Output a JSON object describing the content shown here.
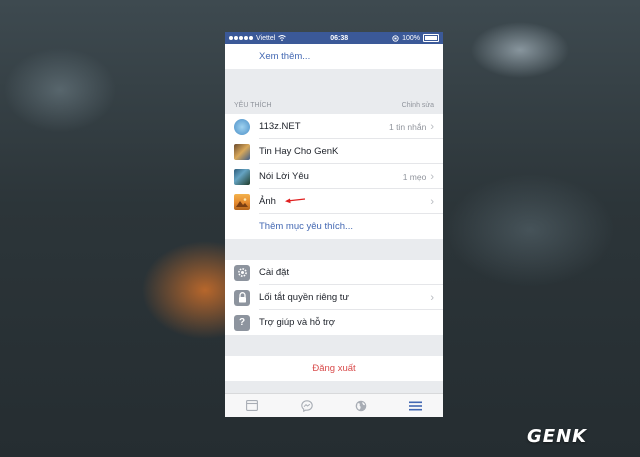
{
  "statusbar": {
    "carrier": "Viettel",
    "time": "06:38",
    "battery": "100%"
  },
  "see_more": "Xem thêm...",
  "favorites": {
    "header": "YÊU THÍCH",
    "edit": "Chỉnh sửa",
    "items": [
      {
        "label": "113z.NET",
        "value": "1 tin nhắn",
        "icon": "page-avatar-icon"
      },
      {
        "label": "Tin Hay Cho GenK",
        "value": "",
        "icon": "page-avatar-icon"
      },
      {
        "label": "Nói Lời Yêu",
        "value": "1 mẹo",
        "icon": "page-avatar-icon"
      },
      {
        "label": "Ảnh",
        "value": "",
        "icon": "photos-icon"
      }
    ],
    "add_more": "Thêm mục yêu thích..."
  },
  "settings": {
    "items": [
      {
        "label": "Cài đặt",
        "icon": "gear-icon"
      },
      {
        "label": "Lối tắt quyền riêng tư",
        "icon": "lock-icon"
      },
      {
        "label": "Trợ giúp và hỗ trợ",
        "icon": "question-icon",
        "glyph": "?"
      }
    ]
  },
  "logout": "Đăng xuất",
  "tabbar": [
    "news-feed-icon",
    "messenger-icon",
    "globe-icon",
    "menu-icon"
  ],
  "watermark": "GENK",
  "colors": {
    "brand": "#3b5998",
    "link": "#4267b2",
    "logout": "#d94b4b",
    "active_tab": "#4267b2"
  }
}
